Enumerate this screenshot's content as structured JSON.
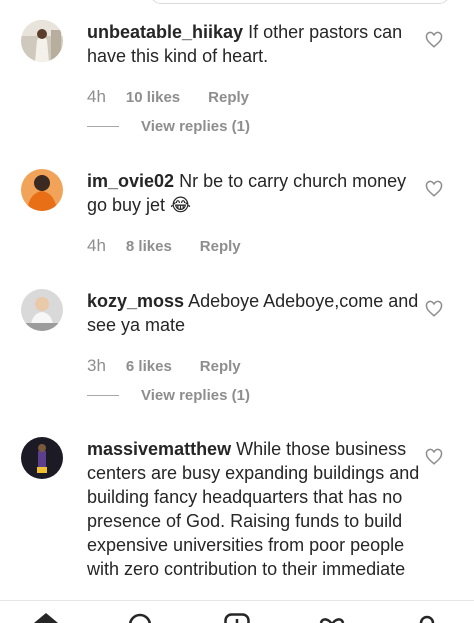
{
  "comments": [
    {
      "username": "unbeatable_hiikay",
      "text": "If other pastors can have this kind of heart.",
      "time": "4h",
      "likes": "10 likes",
      "reply": "Reply",
      "view_replies": "View replies (1)"
    },
    {
      "username": "im_ovie02",
      "text": "Nr be to carry church money go buy jet 😂",
      "time": "4h",
      "likes": "8 likes",
      "reply": "Reply"
    },
    {
      "username": "kozy_moss",
      "text": "Adeboye Adeboye,come and see ya mate",
      "time": "3h",
      "likes": "6 likes",
      "reply": "Reply",
      "view_replies": "View replies (1)"
    },
    {
      "username": "massivematthew",
      "text": "While those business centers are busy expanding buildings and building fancy headquarters that has no presence of God. Raising funds to build expensive universities from poor people with zero contribution to their immediate"
    }
  ],
  "icons": {
    "like": "heart-outline-icon",
    "nav": [
      "home-icon",
      "search-icon",
      "add-post-icon",
      "activity-heart-icon",
      "profile-icon"
    ]
  },
  "colors": {
    "text": "#262626",
    "secondary": "#8e8e8e",
    "divider": "#dbdbdb"
  }
}
